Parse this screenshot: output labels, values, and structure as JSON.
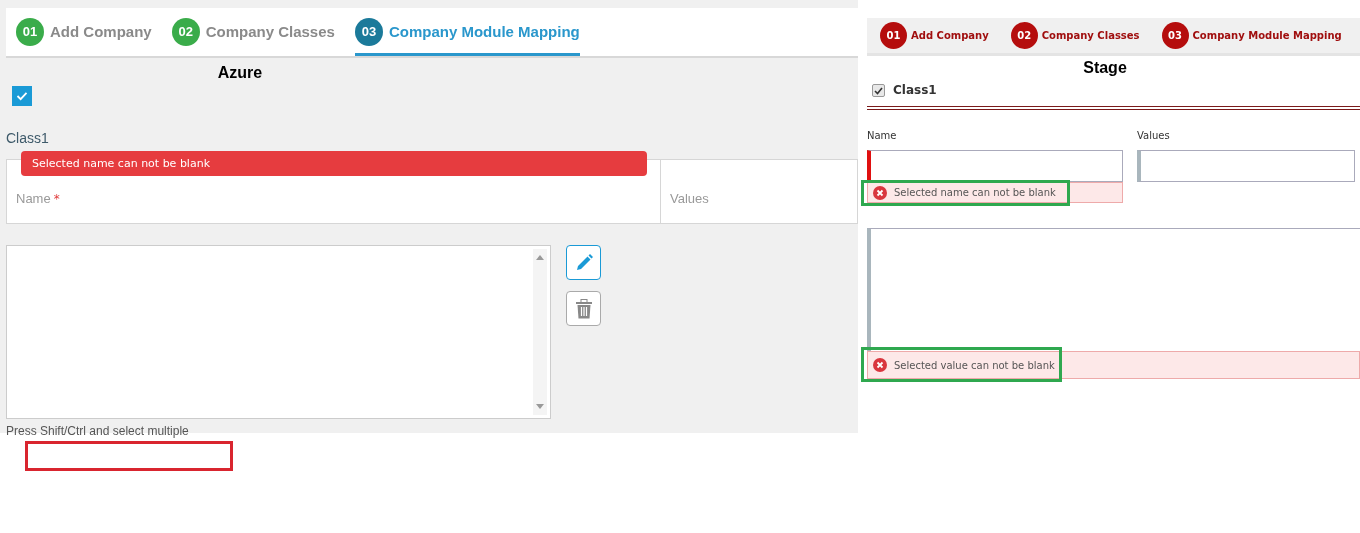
{
  "azure": {
    "steps": [
      {
        "number": "01",
        "label": "Add Company",
        "selected": false
      },
      {
        "number": "02",
        "label": "Company Classes",
        "selected": false
      },
      {
        "number": "03",
        "label": "Company Module Mapping",
        "selected": true
      }
    ],
    "heading": "Azure",
    "select_all_checked": true,
    "class_name": "Class1",
    "tooltip": "Selected name can not be blank",
    "name_label": "Name",
    "required_marker": "*",
    "values_label": "Values",
    "hint": "Press Shift/Ctrl and select multiple"
  },
  "stage": {
    "steps": [
      {
        "number": "01",
        "label": "Add Company"
      },
      {
        "number": "02",
        "label": "Company Classes"
      },
      {
        "number": "03",
        "label": "Company Module Mapping"
      }
    ],
    "heading": "Stage",
    "class_checked": true,
    "class_name": "Class1",
    "name_label": "Name",
    "values_label": "Values",
    "name_error": "Selected name can not be blank",
    "value_error": "Selected value can not be blank"
  }
}
